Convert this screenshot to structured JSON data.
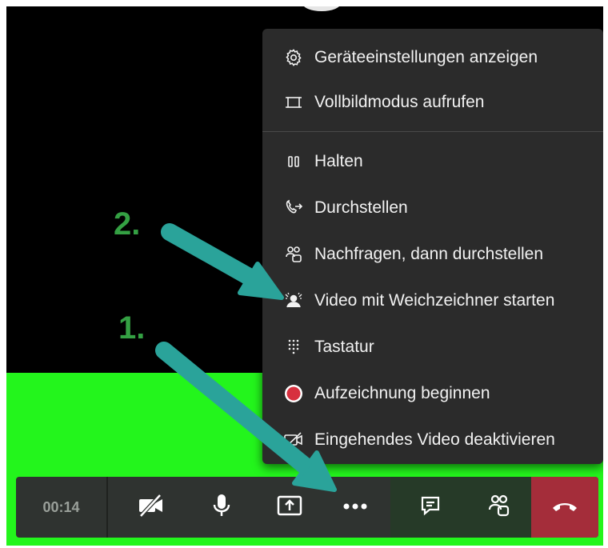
{
  "menu": {
    "items": [
      {
        "label": "Geräteeinstellungen anzeigen",
        "icon": "gear-icon"
      },
      {
        "label": "Vollbildmodus aufrufen",
        "icon": "fullscreen-icon"
      },
      {
        "label": "Halten",
        "icon": "pause-icon"
      },
      {
        "label": "Durchstellen",
        "icon": "transfer-icon"
      },
      {
        "label": "Nachfragen, dann durchstellen",
        "icon": "consult-transfer-icon"
      },
      {
        "label": "Video mit Weichzeichner starten",
        "icon": "blur-video-icon"
      },
      {
        "label": "Tastatur",
        "icon": "dialpad-icon"
      },
      {
        "label": "Aufzeichnung beginnen",
        "icon": "record-icon"
      },
      {
        "label": "Eingehendes Video deaktivieren",
        "icon": "video-off-icon"
      }
    ]
  },
  "callbar": {
    "timer": "00:14",
    "buttons": [
      "camera-off-icon",
      "microphone-icon",
      "share-screen-icon",
      "more-options-icon",
      "chat-icon",
      "participants-icon",
      "hang-up-icon"
    ]
  },
  "annotations": {
    "step1": "1.",
    "step2": "2."
  },
  "colors": {
    "menu_bg": "#2b2b2b",
    "callbar_bg": "#2f3330",
    "hangup": "#a42d3a",
    "record_red": "#d7303f",
    "annotation_green": "#34a043",
    "arrow_teal": "#2aa39a",
    "green_screen": "#23f51c"
  }
}
